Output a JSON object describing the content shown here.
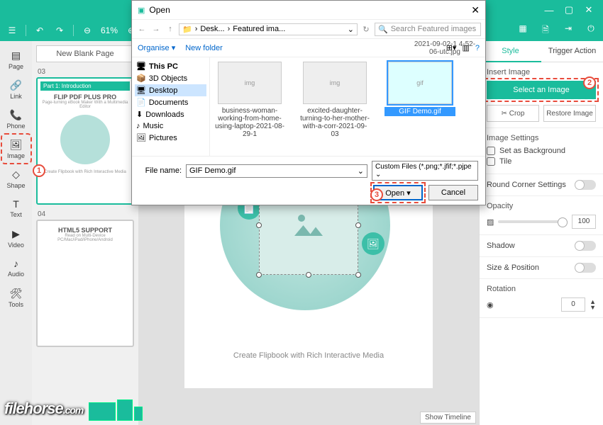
{
  "titlebar": {
    "min": "—",
    "max": "▢",
    "close": "✕"
  },
  "toolbar": {
    "zoom": "61%",
    "right_icons": [
      "qr",
      "save",
      "export",
      "exit"
    ]
  },
  "left_tools": [
    {
      "icon": "▤",
      "label": "Page"
    },
    {
      "icon": "🔗",
      "label": "Link"
    },
    {
      "icon": "📞",
      "label": "Phone"
    },
    {
      "icon": "🖼",
      "label": "Image"
    },
    {
      "icon": "◇",
      "label": "Shape"
    },
    {
      "icon": "T",
      "label": "Text"
    },
    {
      "icon": "▶",
      "label": "Video"
    },
    {
      "icon": "♪",
      "label": "Audio"
    },
    {
      "icon": "🛠",
      "label": "Tools"
    }
  ],
  "pages": {
    "new_page": "New Blank Page",
    "page_num_1": "03",
    "page_num_2": "04",
    "thumb1": {
      "bar": "Part 1: Introduction",
      "title": "FLIP PDF PLUS PRO",
      "sub": "Page-turning eBook Maker With a Multimedia Editor",
      "foot": "Create Flipbook with Rich Interactive Media"
    },
    "thumb2": {
      "title": "HTML5 SUPPORT",
      "sub": "Read on Multi-Device PC/Mac/iPad/iPhone/Android"
    }
  },
  "canvas": {
    "caption": "Create Flipbook with Rich Interactive Media",
    "show_timeline": "Show Timeline"
  },
  "right": {
    "tabs": [
      "Style",
      "Trigger Action"
    ],
    "insert_image": "Insert Image",
    "select_image": "Select an Image",
    "crop": "✂ Crop",
    "restore": "Restore Image",
    "image_settings": "Image Settings",
    "set_bg": "Set as Background",
    "tile": "Tile",
    "round_corner": "Round Corner Settings",
    "opacity_label": "Opacity",
    "opacity_value": "100",
    "shadow": "Shadow",
    "size_pos": "Size & Position",
    "rotation": "Rotation",
    "rotation_value": "0"
  },
  "dialog": {
    "title": "Open",
    "path": [
      "Desk...",
      "Featured ima..."
    ],
    "refresh": "↻",
    "search_placeholder": "Search Featured images",
    "organise": "Organise ▾",
    "new_folder": "New folder",
    "view_icons": [
      "⊞▾",
      "▥",
      "?"
    ],
    "tree": [
      {
        "icon": "🖥",
        "label": "This PC",
        "bold": true
      },
      {
        "icon": "📦",
        "label": "3D Objects"
      },
      {
        "icon": "🖥",
        "label": "Desktop",
        "sel": true
      },
      {
        "icon": "📄",
        "label": "Documents"
      },
      {
        "icon": "⬇",
        "label": "Downloads"
      },
      {
        "icon": "♪",
        "label": "Music"
      },
      {
        "icon": "🖼",
        "label": "Pictures"
      }
    ],
    "extra_file_label": "2021-09-02-1 4-52-06-utc.jpg",
    "files": [
      {
        "name": "business-woman-working-from-home-using-laptop-2021-08-29-1"
      },
      {
        "name": "excited-daughter-turning-to-her-mother-with-a-corr-2021-09-03"
      },
      {
        "name": "GIF Demo.gif",
        "sel": true
      }
    ],
    "filename_label": "File name:",
    "filename_value": "GIF Demo.gif",
    "filetype": "Custom Files (*.png;*.jfif;*.pjpe",
    "open_btn": "Open",
    "cancel_btn": "Cancel"
  },
  "annotations": {
    "a1": "1",
    "a2": "2",
    "a3": "3"
  },
  "watermark": {
    "main": "filehorse",
    "suffix": ".com"
  }
}
